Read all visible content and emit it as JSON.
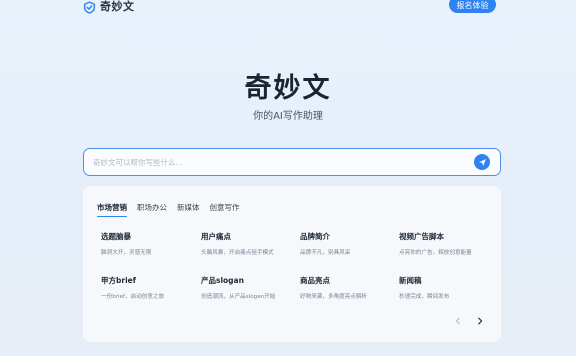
{
  "header": {
    "logo_text": "奇妙文",
    "signup_label": "报名体验"
  },
  "hero": {
    "title": "奇妙文",
    "subtitle": "你的AI写作助理"
  },
  "search": {
    "placeholder": "奇妙文可以帮你写些什么..."
  },
  "tabs": [
    {
      "label": "市场营销",
      "active": true
    },
    {
      "label": "职场办公",
      "active": false
    },
    {
      "label": "新媒体",
      "active": false
    },
    {
      "label": "创意写作",
      "active": false
    }
  ],
  "cards": [
    {
      "title": "选题脑暴",
      "desc": "脑洞大开，灵感无限"
    },
    {
      "title": "用户痛点",
      "desc": "头脑风暴，开启痛点狙手模式"
    },
    {
      "title": "品牌简介",
      "desc": "品牌不凡，别具风采"
    },
    {
      "title": "视频广告脚本",
      "desc": "点亮你的广告，释放创意能量"
    },
    {
      "title": "甲方brief",
      "desc": "一份brief，启动创意之旅"
    },
    {
      "title": "产品slogan",
      "desc": "创造潮流，从产品slogan开始"
    },
    {
      "title": "商品亮点",
      "desc": "好物来袭，多角度亮点解析"
    },
    {
      "title": "新闻稿",
      "desc": "秒速完成，瞬间发布"
    }
  ],
  "icons": {
    "logo": "logo-shield-icon",
    "send": "send-arrow-icon",
    "prev": "chevron-left-icon",
    "next": "chevron-right-icon"
  },
  "colors": {
    "accent": "#2f83f0",
    "background": "#e7eff9"
  }
}
